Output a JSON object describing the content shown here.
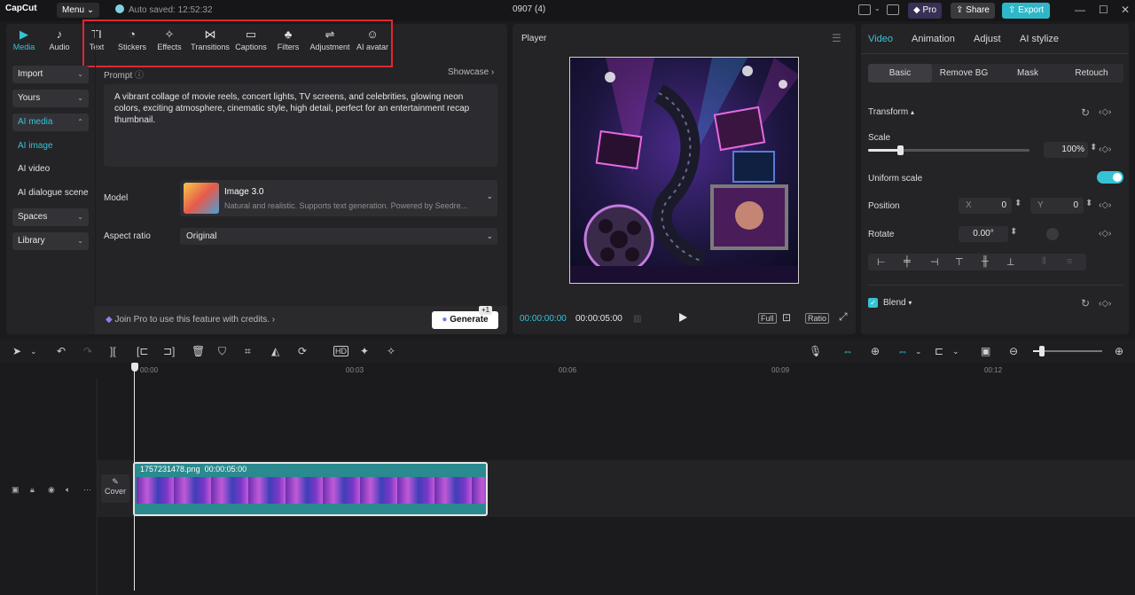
{
  "app": {
    "logo": "CapCut",
    "menu_label": "Menu ⌄",
    "autosave": "Auto saved: 12:52:32",
    "project_title": "0907 (4)",
    "pro_label": "Pro",
    "share_label": "Share",
    "export_label": "Export"
  },
  "toolbar": {
    "items": [
      {
        "label": "Media",
        "icon": "▶"
      },
      {
        "label": "Audio",
        "icon": "♪"
      },
      {
        "label": "Text",
        "icon": "TI"
      },
      {
        "label": "Stickers",
        "icon": "◔"
      },
      {
        "label": "Effects",
        "icon": "✧"
      },
      {
        "label": "Transitions",
        "icon": "⋈"
      },
      {
        "label": "Captions",
        "icon": "▭"
      },
      {
        "label": "Filters",
        "icon": "♣"
      },
      {
        "label": "Adjustment",
        "icon": "⇌"
      },
      {
        "label": "AI avatar",
        "icon": "☺"
      }
    ]
  },
  "sidebar": {
    "items": [
      {
        "label": "Import"
      },
      {
        "label": "Yours"
      },
      {
        "label": "AI media"
      },
      {
        "label": "Spaces"
      },
      {
        "label": "Library"
      }
    ],
    "subitems": [
      {
        "label": "AI image"
      },
      {
        "label": "AI video"
      },
      {
        "label": "AI dialogue scene"
      }
    ]
  },
  "ai_image": {
    "prompt_label": "Prompt",
    "showcase_label": "Showcase",
    "prompt_text": "A vibrant collage of movie reels, concert lights, TV screens, and celebrities, glowing neon colors, exciting atmosphere, cinematic style, high detail, perfect for an entertainment recap thumbnail.",
    "model_label": "Model",
    "model_name": "Image 3.0",
    "model_desc": "Natural and realistic. Supports text generation. Powered by Seedre...",
    "aspect_label": "Aspect ratio",
    "aspect_value": "Original",
    "join_pro": "Join Pro to use this feature with credits.",
    "generate_label": "Generate",
    "credit_badge": "+1"
  },
  "player": {
    "title": "Player",
    "current_time": "00:00:00:00",
    "total_time": "00:00:05:00",
    "full_label": "Full",
    "ratio_label": "Ratio"
  },
  "properties": {
    "tabs": [
      "Video",
      "Animation",
      "Adjust",
      "AI stylize"
    ],
    "subtabs": [
      "Basic",
      "Remove BG",
      "Mask",
      "Retouch"
    ],
    "transform_label": "Transform",
    "scale_label": "Scale",
    "scale_value": "100%",
    "scale_slider_fraction": 0.2,
    "uniform_scale_label": "Uniform scale",
    "position_label": "Position",
    "pos_x_label": "X",
    "pos_x_value": "0",
    "pos_y_label": "Y",
    "pos_y_value": "0",
    "rotate_label": "Rotate",
    "rotate_value": "0.00°",
    "blend_label": "Blend"
  },
  "timeline": {
    "ticks": [
      "00:00",
      "00:03",
      "00:06",
      "00:09",
      "00:12"
    ],
    "clip_name": "1757231478.png",
    "clip_duration": "00:00:05:00",
    "cover_label": "Cover"
  },
  "colors": {
    "accent": "#36c3d4",
    "highlight": "#e0282e",
    "export": "#2fb7c9"
  }
}
